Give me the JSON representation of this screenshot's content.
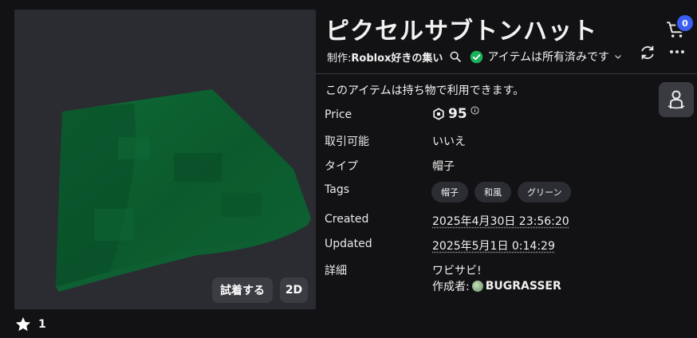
{
  "item": {
    "title": "ピクセルサブトンハット",
    "creator_prefix": "制作: ",
    "creator": "Roblox好きの集い",
    "owned_text": "アイテムは所有済みです",
    "usable_note": "このアイテムは持ち物で利用できます。",
    "favorites": "1"
  },
  "preview": {
    "try_on_label": "試着する",
    "view_2d_label": "2D"
  },
  "cart": {
    "count": "0"
  },
  "details": {
    "price_label": "Price",
    "price_value": "95",
    "tradable_label": "取引可能",
    "tradable_value": "いいえ",
    "type_label": "タイプ",
    "type_value": "帽子",
    "tags_label": "Tags",
    "tags": [
      "帽子",
      "和風",
      "グリーン"
    ],
    "created_label": "Created",
    "created_value": "2025年4月30日 23:56:20",
    "updated_label": "Updated",
    "updated_value": "2025年5月1日 0:14:29",
    "desc_label": "詳細",
    "desc_value": "ワビサビ!",
    "author_prefix": "作成者: ",
    "author_name": "BUGRASSER"
  },
  "icons": {
    "search": "search-icon",
    "check": "check-circle-icon",
    "cart": "cart-icon",
    "refresh": "refresh-icon",
    "more": "more-icon",
    "avatar": "avatar-icon",
    "robux": "robux-icon",
    "star": "star-icon"
  },
  "colors": {
    "background": "#121215",
    "owned_check": "#19b25a",
    "badge": "#3d5ef2",
    "hat": "#0c5a2e"
  }
}
